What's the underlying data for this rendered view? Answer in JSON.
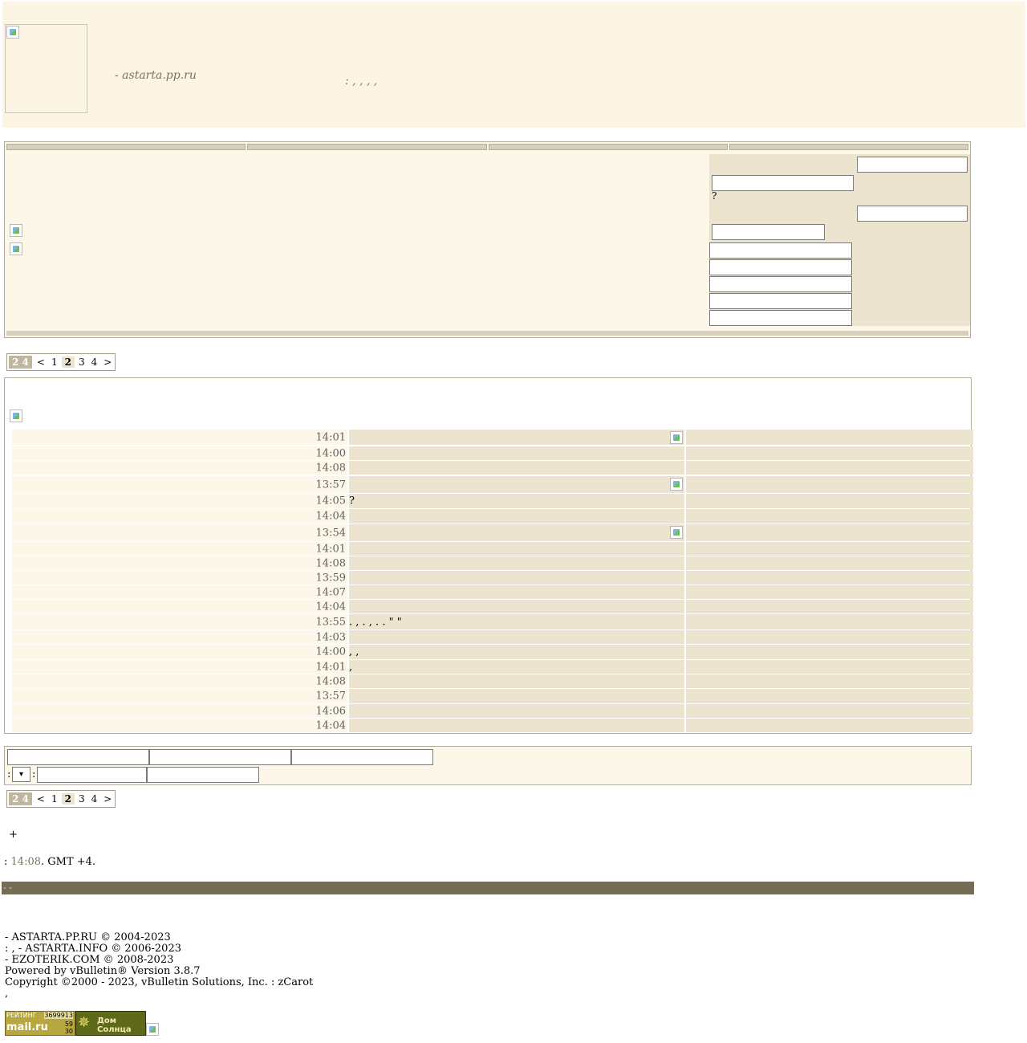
{
  "header": {
    "site_name": "- astarta.pp.ru",
    "tagline": ": , , , ,"
  },
  "login": {
    "question_mark": "?"
  },
  "pagination": {
    "current": "2 4",
    "prev": "<",
    "pages": [
      "1",
      "2",
      "3",
      "4"
    ],
    "next": ">"
  },
  "threads": {
    "rows": [
      {
        "time": "14:01",
        "title": "",
        "icon": true
      },
      {
        "time": "14:00",
        "title": "",
        "icon": false
      },
      {
        "time": "14:08",
        "title": "",
        "icon": false
      },
      {
        "time": "13:57",
        "title": "",
        "icon": true
      },
      {
        "time": "14:05",
        "title": "?",
        "icon": false
      },
      {
        "time": "14:04",
        "title": "",
        "icon": false
      },
      {
        "time": "13:54",
        "title": "",
        "icon": true
      },
      {
        "time": "14:01",
        "title": "",
        "icon": false
      },
      {
        "time": "14:08",
        "title": "",
        "icon": false
      },
      {
        "time": "13:59",
        "title": "",
        "icon": false
      },
      {
        "time": "14:07",
        "title": "",
        "icon": false
      },
      {
        "time": "14:04",
        "title": "",
        "icon": false
      },
      {
        "time": "13:55",
        "title": ". , . , . . \" \"",
        "icon": false
      },
      {
        "time": "14:03",
        "title": "",
        "icon": false
      },
      {
        "time": "14:00",
        "title": ", ,",
        "icon": false
      },
      {
        "time": "14:01",
        "title": ",",
        "icon": false
      },
      {
        "time": "14:08",
        "title": "",
        "icon": false
      },
      {
        "time": "13:57",
        "title": "",
        "icon": false
      },
      {
        "time": "14:06",
        "title": "",
        "icon": false
      },
      {
        "time": "14:04",
        "title": "",
        "icon": false
      }
    ]
  },
  "controls": {
    "sort_label": ":",
    "order_label": ":"
  },
  "footer": {
    "plus": "+",
    "time_prefix": ":",
    "time": "14:08",
    "time_suffix": ". GMT +4.",
    "bar_text": "- -",
    "credits": [
      "- ASTARTA.PP.RU © 2004-2023",
      ": , - ASTARTA.INFO © 2006-2023",
      "- EZOTERIK.COM © 2008-2023",
      "Powered by vBulletin® Version 3.8.7",
      "Copyright ©2000 - 2023, vBulletin Solutions, Inc. : zCarot",
      ","
    ],
    "counter_label": "РЕЙТИНГ",
    "counter_value": "3699913",
    "counter_brand": "mail.ru",
    "counter_small1": "59",
    "counter_small2": "30",
    "banner_text": "Дом Солнца"
  }
}
